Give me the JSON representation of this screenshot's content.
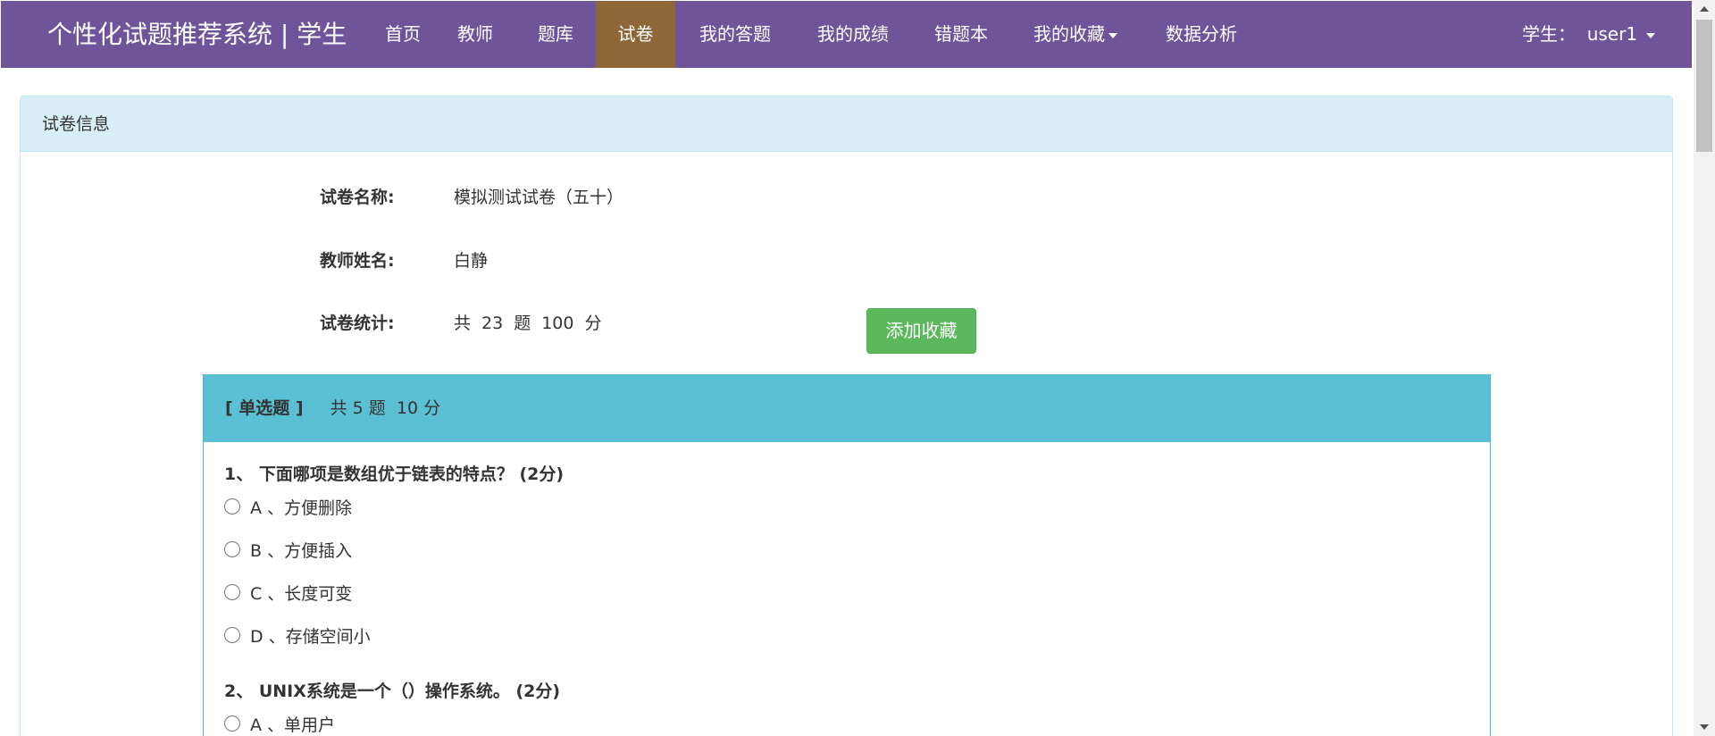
{
  "navbar": {
    "brand": "个性化试题推荐系统 | 学生",
    "items": [
      {
        "label": "首页"
      },
      {
        "label": "教师"
      },
      {
        "label": "题库"
      },
      {
        "label": "试卷"
      },
      {
        "label": "我的答题"
      },
      {
        "label": "我的成绩"
      },
      {
        "label": "错题本"
      },
      {
        "label": "我的收藏"
      },
      {
        "label": "数据分析"
      }
    ],
    "active_item": "试卷",
    "user_label": "学生：  user1"
  },
  "panel": {
    "heading": "试卷信息",
    "paper_name_label": "试卷名称:",
    "paper_name": "模拟测试试卷（五十）",
    "teacher_label": "教师姓名:",
    "teacher_name": "白静",
    "stats_label": "试卷统计:",
    "stats": {
      "prefix": "共",
      "question_count": "23",
      "question_unit": "题",
      "score": "100",
      "score_unit": "分"
    },
    "favorite_button": "添加收藏"
  },
  "section": {
    "type": "[ 单选题 ]",
    "summary": "共 5 题  10 分"
  },
  "questions": [
    {
      "title": "1、 下面哪项是数组优于链表的特点？ (2分)",
      "options": [
        "A 、方便删除",
        "B 、方便插入",
        "C 、长度可变",
        "D 、存储空间小"
      ]
    },
    {
      "title": "2、 UNIX系统是一个（）操作系统。 (2分)",
      "options": [
        "A 、单用户"
      ]
    }
  ],
  "colors": {
    "navbar": "#6f5499",
    "nav_active": "#8d6738",
    "panel_heading": "#d9edf7",
    "section_heading": "#5bc0d3",
    "favorite_button": "#5cb85c"
  }
}
